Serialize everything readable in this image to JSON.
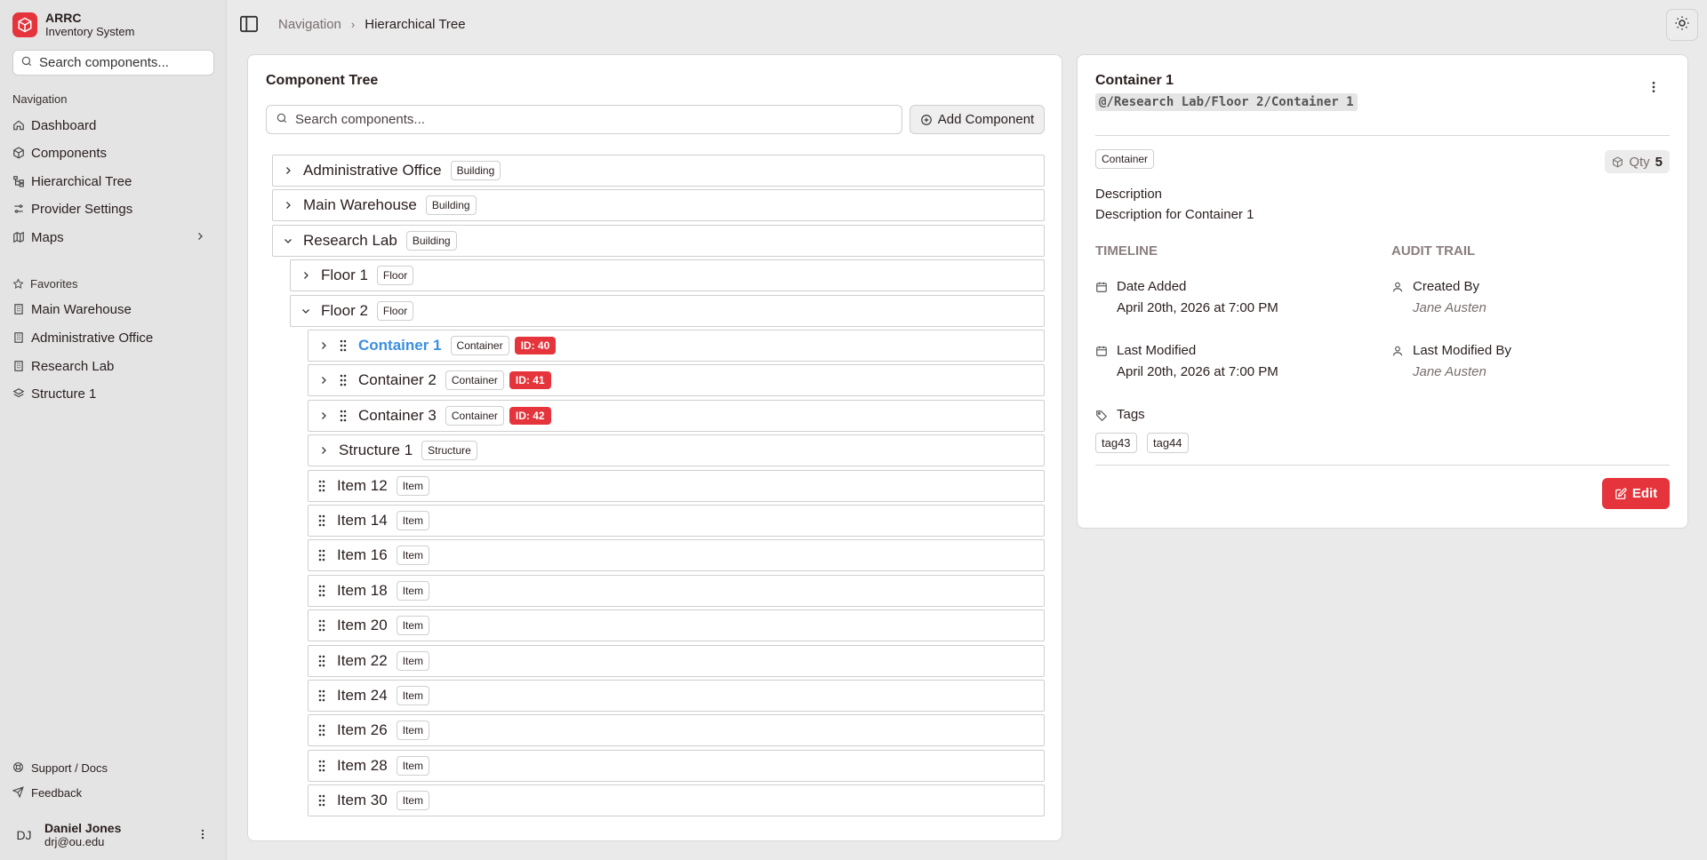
{
  "brand": {
    "title": "ARRC",
    "subtitle": "Inventory System"
  },
  "sidebar": {
    "search_placeholder": "Search components...",
    "nav_label": "Navigation",
    "nav_items": [
      {
        "label": "Dashboard",
        "icon": "home-icon"
      },
      {
        "label": "Components",
        "icon": "box-icon"
      },
      {
        "label": "Hierarchical Tree",
        "icon": "tree-icon"
      },
      {
        "label": "Provider Settings",
        "icon": "sliders-icon"
      },
      {
        "label": "Maps",
        "icon": "map-icon"
      }
    ],
    "favorites_label": "Favorites",
    "favorites": [
      {
        "label": "Main Warehouse",
        "icon": "building-icon"
      },
      {
        "label": "Administrative Office",
        "icon": "building-icon"
      },
      {
        "label": "Research Lab",
        "icon": "building-icon"
      },
      {
        "label": "Structure 1",
        "icon": "layers-icon"
      }
    ],
    "footer_links": [
      {
        "label": "Support / Docs",
        "icon": "lifebuoy-icon"
      },
      {
        "label": "Feedback",
        "icon": "send-icon"
      }
    ],
    "user": {
      "initials": "DJ",
      "name": "Daniel Jones",
      "email": "drj@ou.edu"
    }
  },
  "header": {
    "breadcrumbs": [
      "Navigation",
      "Hierarchical Tree"
    ]
  },
  "tree": {
    "title": "Component Tree",
    "search_placeholder": "Search components...",
    "add_label": "Add Component",
    "rows": [
      {
        "label": "Administrative Office",
        "type": "Building",
        "id": "",
        "level": 0,
        "expander": "right",
        "grip": false,
        "active": false
      },
      {
        "label": "Main Warehouse",
        "type": "Building",
        "id": "",
        "level": 0,
        "expander": "right",
        "grip": false,
        "active": false
      },
      {
        "label": "Research Lab",
        "type": "Building",
        "id": "",
        "level": 0,
        "expander": "down",
        "grip": false,
        "active": false
      },
      {
        "label": "Floor 1",
        "type": "Floor",
        "id": "",
        "level": 1,
        "expander": "right",
        "grip": false,
        "active": false
      },
      {
        "label": "Floor 2",
        "type": "Floor",
        "id": "",
        "level": 1,
        "expander": "down",
        "grip": false,
        "active": false
      },
      {
        "label": "Container 1",
        "type": "Container",
        "id": "ID: 40",
        "level": 2,
        "expander": "right",
        "grip": true,
        "active": true
      },
      {
        "label": "Container 2",
        "type": "Container",
        "id": "ID: 41",
        "level": 2,
        "expander": "right",
        "grip": true,
        "active": false
      },
      {
        "label": "Container 3",
        "type": "Container",
        "id": "ID: 42",
        "level": 2,
        "expander": "right",
        "grip": true,
        "active": false
      },
      {
        "label": "Structure 1",
        "type": "Structure",
        "id": "",
        "level": 2,
        "expander": "right",
        "grip": false,
        "active": false
      },
      {
        "label": "Item 12",
        "type": "Item",
        "id": "",
        "level": 2,
        "expander": "none",
        "grip": true,
        "active": false
      },
      {
        "label": "Item 14",
        "type": "Item",
        "id": "",
        "level": 2,
        "expander": "none",
        "grip": true,
        "active": false
      },
      {
        "label": "Item 16",
        "type": "Item",
        "id": "",
        "level": 2,
        "expander": "none",
        "grip": true,
        "active": false
      },
      {
        "label": "Item 18",
        "type": "Item",
        "id": "",
        "level": 2,
        "expander": "none",
        "grip": true,
        "active": false
      },
      {
        "label": "Item 20",
        "type": "Item",
        "id": "",
        "level": 2,
        "expander": "none",
        "grip": true,
        "active": false
      },
      {
        "label": "Item 22",
        "type": "Item",
        "id": "",
        "level": 2,
        "expander": "none",
        "grip": true,
        "active": false
      },
      {
        "label": "Item 24",
        "type": "Item",
        "id": "",
        "level": 2,
        "expander": "none",
        "grip": true,
        "active": false
      },
      {
        "label": "Item 26",
        "type": "Item",
        "id": "",
        "level": 2,
        "expander": "none",
        "grip": true,
        "active": false
      },
      {
        "label": "Item 28",
        "type": "Item",
        "id": "",
        "level": 2,
        "expander": "none",
        "grip": true,
        "active": false
      },
      {
        "label": "Item 30",
        "type": "Item",
        "id": "",
        "level": 2,
        "expander": "none",
        "grip": true,
        "active": false
      }
    ]
  },
  "details": {
    "title": "Container 1",
    "path": "@/Research Lab/Floor 2/Container 1",
    "type": "Container",
    "qty_label": "Qty",
    "qty_value": "5",
    "description_label": "Description",
    "description": "Description for Container 1",
    "timeline_heading": "TIMELINE",
    "audit_heading": "AUDIT TRAIL",
    "date_added_label": "Date Added",
    "date_added": "April 20th, 2026 at 7:00 PM",
    "last_modified_label": "Last Modified",
    "last_modified": "April 20th, 2026 at 7:00 PM",
    "created_by_label": "Created By",
    "created_by": "Jane Austen",
    "modified_by_label": "Last Modified By",
    "modified_by": "Jane Austen",
    "tags_label": "Tags",
    "tags": [
      "tag43",
      "tag44"
    ],
    "edit_label": "Edit"
  },
  "colors": {
    "accent": "#e5343b",
    "active_link": "#3b8fe0"
  }
}
